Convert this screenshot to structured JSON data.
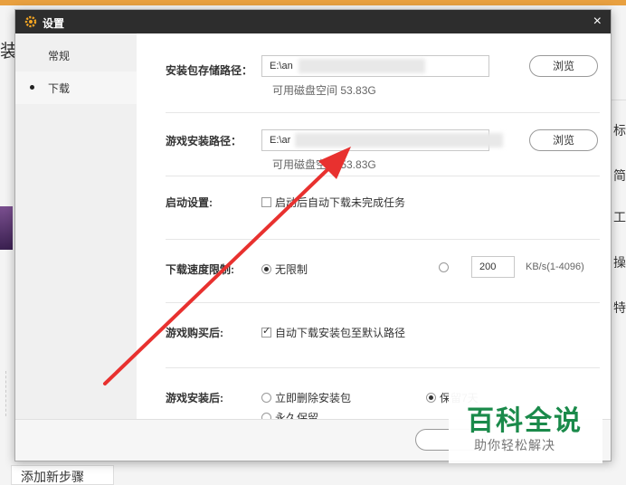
{
  "background": {
    "left_partial_text": "装",
    "right_chars": [
      "标",
      "简",
      "工",
      "操",
      "特"
    ],
    "add_step_label": "添加新步骤"
  },
  "dialog": {
    "title": "设置",
    "close_symbol": "×",
    "sidebar": {
      "items": [
        {
          "label": "常规",
          "active": false
        },
        {
          "label": "下载",
          "active": true
        }
      ]
    },
    "storage_path": {
      "label": "安装包存储路径：",
      "value": "E:\\an",
      "disk_space": "可用磁盘空间 53.83G",
      "browse_label": "浏览"
    },
    "install_path": {
      "label": "游戏安装路径：",
      "value": "E:\\ar",
      "disk_space": "可用磁盘空间 53.83G",
      "browse_label": "浏览"
    },
    "startup": {
      "label": "启动设置:",
      "option": "启动后自动下载未完成任务",
      "checked": false
    },
    "speed_limit": {
      "label": "下载速度限制:",
      "unlimited_label": "无限制",
      "unlimited_selected": true,
      "limit_value": "200",
      "unit": "KB/s(1-4096)"
    },
    "after_purchase": {
      "label": "游戏购买后:",
      "option": "自动下载安装包至默认路径",
      "checked": true
    },
    "after_install": {
      "label": "游戏安装后:",
      "options": [
        "立即删除安装包",
        "保留7天",
        "永久保留"
      ],
      "selected_index": 1
    }
  },
  "watermark": {
    "title": "百科全说",
    "subtitle": "助你轻松解决"
  },
  "colors": {
    "titlebar": "#2d2d2d",
    "title_icon": "#f5a623",
    "arrow": "#e8312f",
    "watermark_green": "#1a8a4a"
  }
}
